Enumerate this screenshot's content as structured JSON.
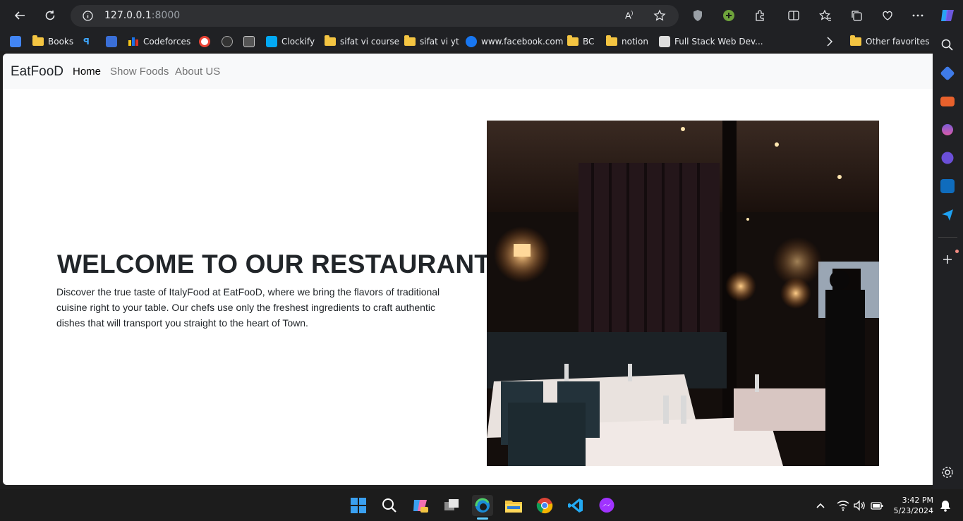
{
  "browser": {
    "address": {
      "host": "127.0.0.1",
      "port": ":8000"
    },
    "bookmarks": [
      {
        "label": "Books",
        "icon": "folder-icon"
      },
      {
        "label": "Codeforces",
        "icon": "codeforces-icon"
      },
      {
        "label": "Clockify",
        "icon": "clockify-icon"
      },
      {
        "label": "sifat vi course",
        "icon": "folder-icon"
      },
      {
        "label": "sifat vi yt",
        "icon": "folder-icon"
      },
      {
        "label": "www.facebook.com",
        "icon": "facebook-icon"
      },
      {
        "label": "BC",
        "icon": "folder-icon"
      },
      {
        "label": "notion",
        "icon": "folder-icon"
      },
      {
        "label": "Full Stack Web Dev...",
        "icon": "page-icon"
      }
    ],
    "other_favorites": "Other favorites"
  },
  "site": {
    "brand": "EatFooD",
    "nav": [
      {
        "label": "Home",
        "active": true
      },
      {
        "label": "Show Foods",
        "active": false
      },
      {
        "label": "About US",
        "active": false
      }
    ],
    "hero": {
      "title": "WELCOME TO OUR RESTAURANT!",
      "text": "Discover the true taste of ItalyFood at EatFooD, where we bring the flavors of traditional cuisine right to your table. Our chefs use only the freshest ingredients to craft authentic dishes that will transport you straight to the heart of Town."
    }
  },
  "taskbar": {
    "time": "3:42 PM",
    "date": "5/23/2024"
  },
  "colors": {
    "browser_bg": "#202124",
    "navbar_bg": "#f8f9fa",
    "text_dark": "#212529",
    "taskbar_bg": "#1c1c1c"
  }
}
